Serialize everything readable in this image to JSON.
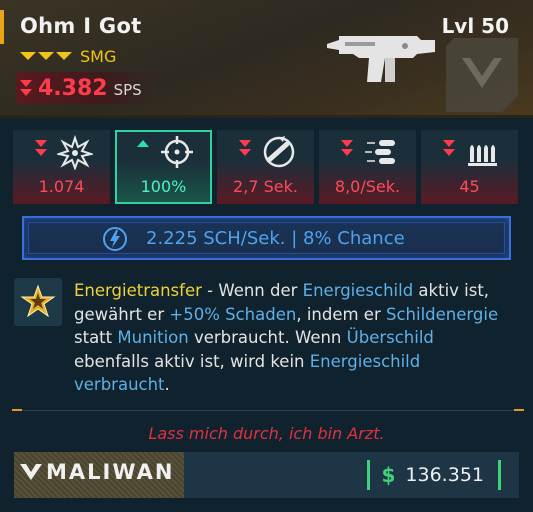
{
  "item": {
    "name": "Ohm I Got",
    "level": "Lvl 50",
    "type": "SMG",
    "sps_value": "4.382",
    "sps_unit": "SPS"
  },
  "colors": {
    "rarity": "#f0c419",
    "stat_down": "#ff3b4c",
    "stat_up": "#2fe0ae",
    "element": "#4ea2f0",
    "money": "#3fd27a"
  },
  "stats": [
    {
      "icon": "damage-icon",
      "trend": "down",
      "value": "1.074"
    },
    {
      "icon": "accuracy-icon",
      "trend": "up",
      "value": "100%"
    },
    {
      "icon": "reload-time-icon",
      "trend": "down",
      "value": "2,7 Sek."
    },
    {
      "icon": "fire-rate-icon",
      "trend": "down",
      "value": "8,0/Sek."
    },
    {
      "icon": "magazine-icon",
      "trend": "down",
      "value": "45"
    }
  ],
  "element": {
    "icon": "shock-icon",
    "text": "2.225 SCH/Sek. | 8% Chance"
  },
  "description": {
    "icon": "perk-star-icon",
    "title": "Energietransfer",
    "p1": " - Wenn der ",
    "k1": "Energieschild",
    "p2": " aktiv ist, gewährt er ",
    "k2": "+50% Schaden",
    "p3": ", indem er ",
    "k3": "Schildenergie",
    "p4": " statt ",
    "k4": "Munition",
    "p5": " verbraucht. Wenn ",
    "k5": "Überschild",
    "p6": " ebenfalls aktiv ist, wird kein ",
    "k6": "Energieschild verbraucht",
    "p7": "."
  },
  "flavor_text": "Lass mich durch, ich bin Arzt.",
  "footer": {
    "manufacturer": "MALIWAN",
    "currency_symbol": "$",
    "price": "136.351"
  }
}
